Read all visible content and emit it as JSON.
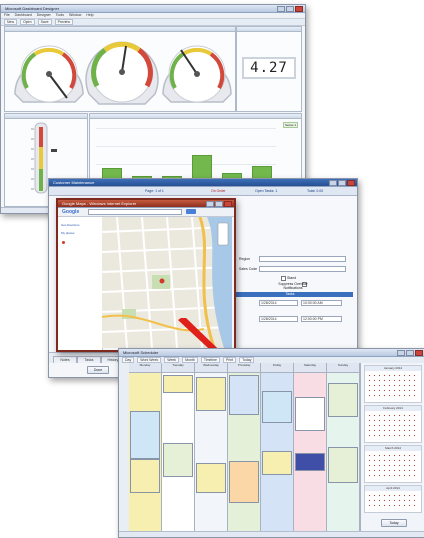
{
  "dashboard": {
    "title": "Microsoft Dashboard Designer",
    "menu": [
      "File",
      "Dashboard",
      "Designer",
      "Tools",
      "Window",
      "Help"
    ],
    "toolbar": [
      "New",
      "Open",
      "Save",
      "Preview"
    ],
    "digital_value": "4.27",
    "gauges": [
      {
        "name": "gauge-left",
        "needle_fraction": 0.75
      },
      {
        "name": "gauge-center",
        "needle_fraction": 0.55
      },
      {
        "name": "gauge-right",
        "needle_fraction": 0.25
      }
    ],
    "bar_values": [
      0.45,
      0.33,
      0.33,
      0.62,
      0.38,
      0.47
    ],
    "legend": "Series 1",
    "accent": "#72b84c"
  },
  "customer_form": {
    "title": "Customer Maintenance",
    "header": [
      "Page: 1 of 1",
      "On Order",
      "Open Tasks: 1",
      "Total: 0.00"
    ],
    "fields": [
      "Region",
      "Sales Code"
    ],
    "checkbox": "Stand",
    "notify_label": "Suppress Overdue Notifications",
    "tasks_header": "Tasks",
    "task_rows": [
      {
        "date": "1/28/2014",
        "time": "10:00:00 AM"
      },
      {
        "date": "1/28/2014",
        "time": "12:00:00 PM"
      }
    ],
    "footer_tabs": [
      "Notes",
      "Tasks",
      "History"
    ],
    "done_button": "Done"
  },
  "map_window": {
    "title": "Google Maps - Windows Internet Explorer",
    "search_value": "",
    "brand": "Google",
    "sidebar_items": [
      "Get directions",
      "My places"
    ]
  },
  "scheduler": {
    "title": "Microsoft Scheduler",
    "toolbar": [
      "Day",
      "Work Week",
      "Week",
      "Month",
      "Timeline",
      "Print",
      "Today"
    ],
    "column_heads": [
      "Monday",
      "Tuesday",
      "Wednesday",
      "Thursday",
      "Friday",
      "Saturday",
      "Sunday"
    ],
    "mini_months": [
      "January 2014",
      "February 2014",
      "March 2014",
      "April 2014"
    ],
    "today_button": "Today"
  }
}
